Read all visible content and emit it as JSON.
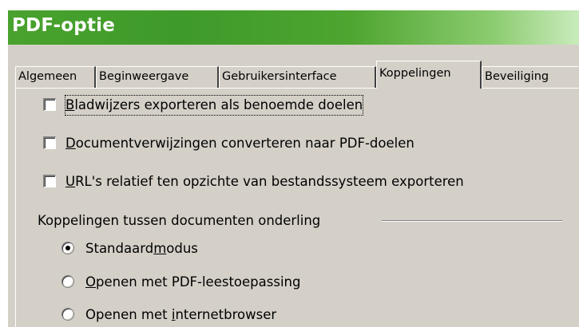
{
  "window": {
    "title": "PDF-optie",
    "colors": {
      "titlebar_start": "#3e9a2a",
      "titlebar_end": "#c9ebbc",
      "dialog_bg": "#d4d0c8"
    }
  },
  "tabs": [
    {
      "label": "Algemeen",
      "active": false
    },
    {
      "label": "Beginweergave",
      "active": false
    },
    {
      "label": "Gebruikersinterface",
      "active": false
    },
    {
      "label": "Koppelingen",
      "active": true
    },
    {
      "label": "Beveiliging",
      "active": false
    }
  ],
  "options": {
    "bookmarks": {
      "pre": "",
      "acc": "B",
      "post": "ladwijzers exporteren als benoemde doelen",
      "checked": false
    },
    "docrefs": {
      "pre": "",
      "acc": "D",
      "post": "ocumentverwijzingen converteren naar PDF-doelen",
      "checked": false
    },
    "relurls": {
      "pre": "",
      "acc": "U",
      "post": "RL's relatief ten opzichte van bestandssysteem exporteren",
      "checked": false
    }
  },
  "group": {
    "label": "Koppelingen tussen documenten onderling",
    "radios": {
      "default": {
        "pre": "Standaard",
        "acc": "m",
        "post": "odus",
        "selected": true
      },
      "pdfreader": {
        "pre": "",
        "acc": "O",
        "post": "penen met PDF-leestoepassing",
        "selected": false
      },
      "browser": {
        "pre": "Openen met ",
        "acc": "i",
        "post": "nternetbrowser",
        "selected": false
      }
    }
  }
}
